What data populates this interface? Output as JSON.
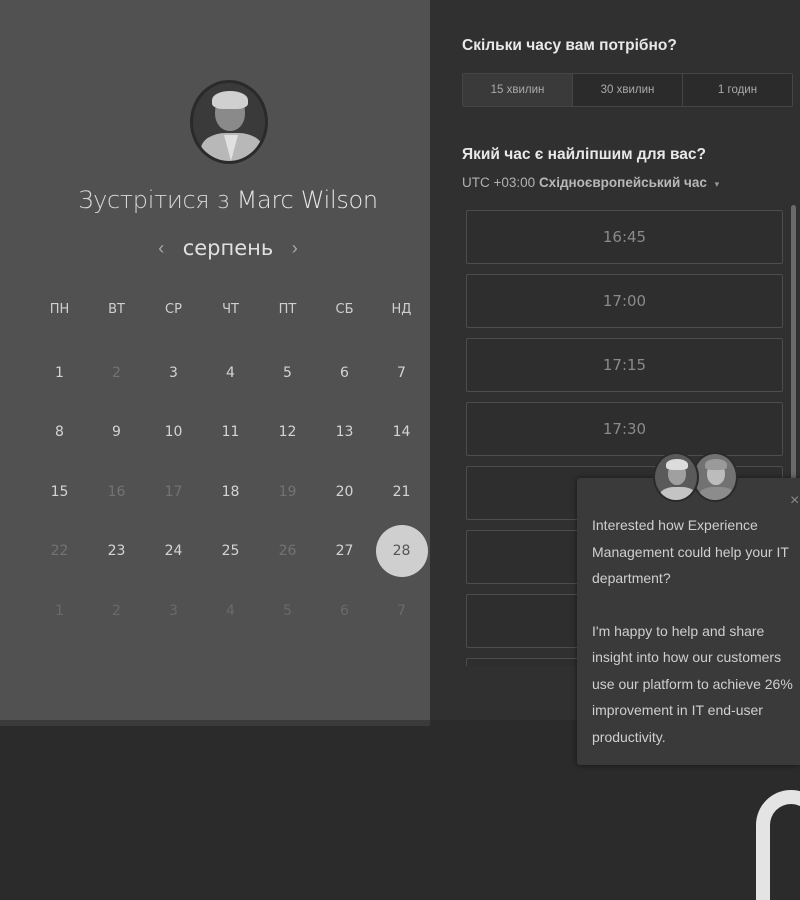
{
  "meeting": {
    "prefix": "Зустрітися з",
    "host_name": "Marc Wilson"
  },
  "calendar": {
    "month": "серпень",
    "prev_arrow": "‹",
    "next_arrow": "›",
    "weekdays": [
      "ПН",
      "ВТ",
      "СР",
      "ЧТ",
      "ПТ",
      "СБ",
      "НД"
    ],
    "weeks": [
      [
        {
          "d": "1",
          "s": "avail"
        },
        {
          "d": "2",
          "s": "dim"
        },
        {
          "d": "3",
          "s": "avail"
        },
        {
          "d": "4",
          "s": "avail"
        },
        {
          "d": "5",
          "s": "avail"
        },
        {
          "d": "6",
          "s": "avail"
        },
        {
          "d": "7",
          "s": "avail"
        }
      ],
      [
        {
          "d": "8",
          "s": "avail"
        },
        {
          "d": "9",
          "s": "avail"
        },
        {
          "d": "10",
          "s": "avail"
        },
        {
          "d": "11",
          "s": "avail"
        },
        {
          "d": "12",
          "s": "avail"
        },
        {
          "d": "13",
          "s": "avail"
        },
        {
          "d": "14",
          "s": "avail"
        }
      ],
      [
        {
          "d": "15",
          "s": "avail"
        },
        {
          "d": "16",
          "s": "dim"
        },
        {
          "d": "17",
          "s": "dim"
        },
        {
          "d": "18",
          "s": "avail"
        },
        {
          "d": "19",
          "s": "dim"
        },
        {
          "d": "20",
          "s": "avail"
        },
        {
          "d": "21",
          "s": "avail"
        }
      ],
      [
        {
          "d": "22",
          "s": "dim"
        },
        {
          "d": "23",
          "s": "avail"
        },
        {
          "d": "24",
          "s": "avail"
        },
        {
          "d": "25",
          "s": "avail"
        },
        {
          "d": "26",
          "s": "dim"
        },
        {
          "d": "27",
          "s": "avail"
        },
        {
          "d": "28",
          "s": "selected"
        }
      ],
      [
        {
          "d": "1",
          "s": "outside"
        },
        {
          "d": "2",
          "s": "outside"
        },
        {
          "d": "3",
          "s": "outside"
        },
        {
          "d": "4",
          "s": "outside"
        },
        {
          "d": "5",
          "s": "outside"
        },
        {
          "d": "6",
          "s": "outside"
        },
        {
          "d": "7",
          "s": "outside"
        }
      ]
    ]
  },
  "booking": {
    "duration_question": "Скільки часу вам потрібно?",
    "durations": [
      "15 хвилин",
      "30 хвилин",
      "1 годин"
    ],
    "active_duration_index": 0,
    "time_question": "Який час є найліпшим для вас?",
    "timezone_offset": "UTC +03:00",
    "timezone_name": "Східноєвропейський час",
    "timezone_caret": "▾",
    "slots": [
      "16:45",
      "17:00",
      "17:15",
      "17:30",
      "",
      "",
      "",
      ""
    ]
  },
  "chat": {
    "close": "×",
    "message_1": "Interested how Experience Management could help your IT department?",
    "message_2": "I'm happy to help and share insight into how our customers use our platform to achieve 26% improvement in IT end-user productivity."
  },
  "colors": {
    "left_panel_bg": "#515151",
    "right_panel_bg": "#303030",
    "selected_day": "#cfcfcf"
  }
}
